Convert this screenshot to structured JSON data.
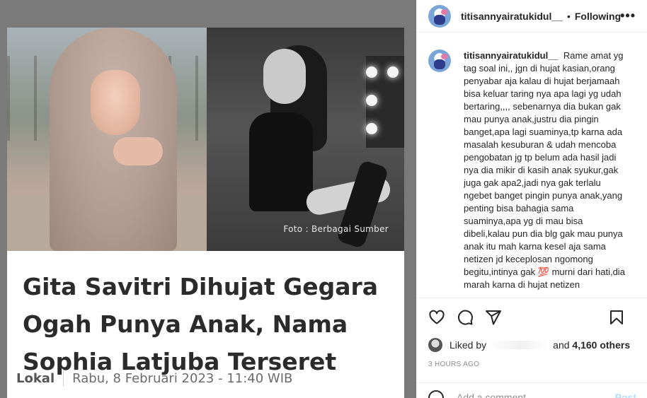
{
  "media": {
    "photo_credit": "Foto : Berbagai Sumber",
    "headline": "Gita Savitri Dihujat Gegara Ogah Punya Anak, Nama Sophia Latjuba Terseret",
    "category": "Lokal",
    "date": "Rabu, 8 Februari 2023 - 11:40 WIB"
  },
  "header": {
    "username": "titisannyairatukidul__",
    "dot": "•",
    "follow_label": "Following",
    "more_icon": "more-horizontal-icon"
  },
  "comment": {
    "username": "titisannyairatukidul__",
    "text": "Rame amat yg tag soal ini,, jgn di hujat kasian,orang penyabar aja kalau di hujat berjamaah bisa keluar taring nya apa lagi yg udah bertaring,,,, sebenarnya dia bukan gak mau punya anak,justru dia pingin banget,apa lagi suaminya,tp karna ada masalah kesuburan & udah mencoba pengobatan jg tp belum ada hasil jadi nya dia mikir di kasih anak syukur,gak juga gak apa2,jadi nya gak terlalu ngebet banget pingin punya anak,yang penting bisa bahagia sama suaminya,apa yg di mau bisa dibeli,kalau pun dia blg gak mau punya anak itu mah karna kesel aja sama netizen jd keceplosan ngomong begitu,intinya gak 💯 murni dari hati,dia marah karna di hujat netizen"
  },
  "actions": {
    "like_icon": "heart-icon",
    "comment_icon": "comment-icon",
    "share_icon": "send-icon",
    "save_icon": "bookmark-icon"
  },
  "likes": {
    "prefix": "Liked by",
    "suffix": "and",
    "count": "4,160 others"
  },
  "timestamp": "3 HOURS AGO",
  "add_comment": {
    "placeholder": "Add a comment…",
    "post_label": "Post"
  }
}
